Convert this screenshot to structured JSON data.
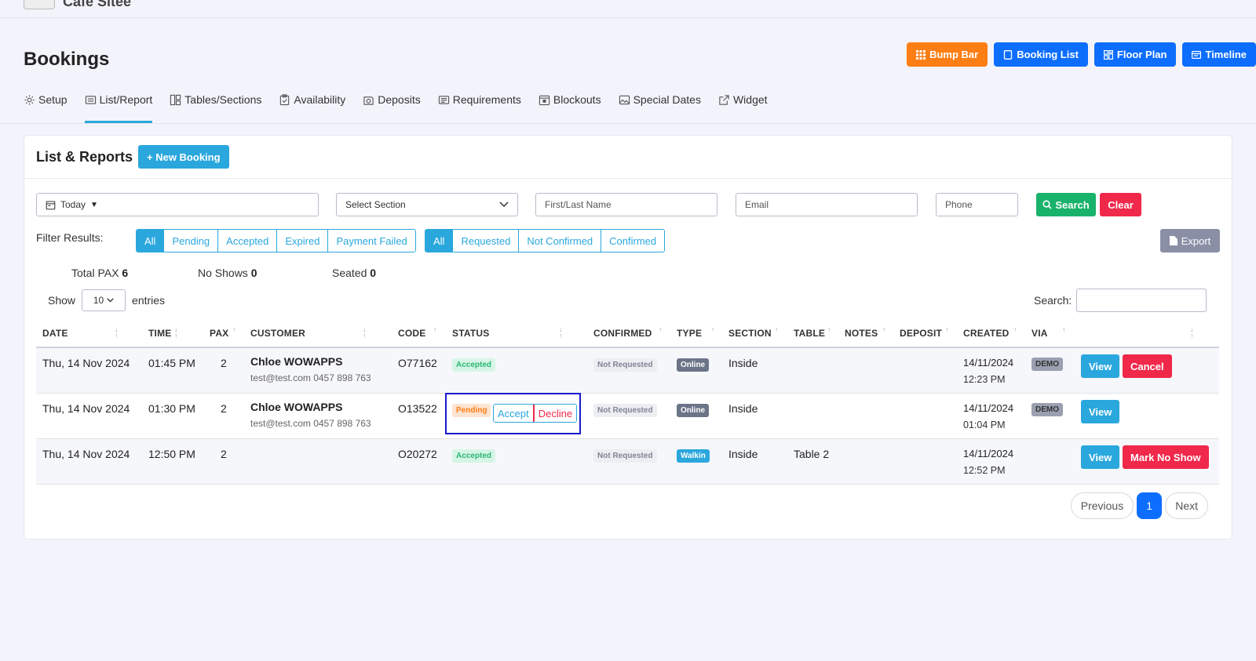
{
  "app": {
    "name": "Cafe Sitee"
  },
  "page": {
    "title": "Bookings"
  },
  "top_buttons": {
    "bump_bar": "Bump Bar",
    "booking_list": "Booking List",
    "floor_plan": "Floor Plan",
    "timeline": "Timeline"
  },
  "tabs": [
    {
      "label": "Setup",
      "icon": "gear-icon"
    },
    {
      "label": "List/Report",
      "icon": "list-icon",
      "active": true
    },
    {
      "label": "Tables/Sections",
      "icon": "tables-icon"
    },
    {
      "label": "Availability",
      "icon": "clipboard-icon"
    },
    {
      "label": "Deposits",
      "icon": "deposit-icon"
    },
    {
      "label": "Requirements",
      "icon": "requirements-icon"
    },
    {
      "label": "Blockouts",
      "icon": "calendar-icon"
    },
    {
      "label": "Special Dates",
      "icon": "image-icon"
    },
    {
      "label": "Widget",
      "icon": "external-link-icon"
    }
  ],
  "card": {
    "title": "List & Reports",
    "new_booking": "+ New Booking"
  },
  "filters": {
    "date_value": "Today",
    "section_placeholder": "Select Section",
    "name_placeholder": "First/Last Name",
    "email_placeholder": "Email",
    "phone_placeholder": "Phone",
    "search_btn": "Search",
    "clear_btn": "Clear",
    "filter_label": "Filter Results:",
    "group1": [
      "All",
      "Pending",
      "Accepted",
      "Expired",
      "Payment Failed"
    ],
    "group2": [
      "All",
      "Requested",
      "Not Confirmed",
      "Confirmed"
    ],
    "export": "Export"
  },
  "stats": {
    "total_pax_label": "Total PAX",
    "total_pax": "6",
    "no_shows_label": "No Shows",
    "no_shows": "0",
    "seated_label": "Seated",
    "seated": "0"
  },
  "table_controls": {
    "show": "Show",
    "entries_value": "10",
    "entries": "entries",
    "search": "Search:"
  },
  "columns": [
    "DATE",
    "TIME",
    "PAX",
    "CUSTOMER",
    "CODE",
    "STATUS",
    "CONFIRMED",
    "TYPE",
    "SECTION",
    "TABLE",
    "NOTES",
    "DEPOSIT",
    "CREATED",
    "VIA"
  ],
  "rows": [
    {
      "date": "Thu, 14 Nov 2024",
      "time": "01:45 PM",
      "pax": "2",
      "customer": "Chloe WOWAPPS",
      "contact": "test@test.com 0457 898 763",
      "code": "O77162",
      "status": "Accepted",
      "confirmed": "Not Requested",
      "type": "Online",
      "section": "Inside",
      "table": "",
      "created_date": "14/11/2024",
      "created_time": "12:23 PM",
      "via": "DEMO",
      "actions": [
        "View",
        "Cancel"
      ]
    },
    {
      "date": "Thu, 14 Nov 2024",
      "time": "01:30 PM",
      "pax": "2",
      "customer": "Chloe WOWAPPS",
      "contact": "test@test.com 0457 898 763",
      "code": "O13522",
      "status": "Pending",
      "accept": "Accept",
      "decline": "Decline",
      "confirmed": "Not Requested",
      "type": "Online",
      "section": "Inside",
      "table": "",
      "created_date": "14/11/2024",
      "created_time": "01:04 PM",
      "via": "DEMO",
      "actions": [
        "View"
      ]
    },
    {
      "date": "Thu, 14 Nov 2024",
      "time": "12:50 PM",
      "pax": "2",
      "customer": "",
      "contact": "",
      "code": "O20272",
      "status": "Accepted",
      "confirmed": "Not Requested",
      "type": "Walkin",
      "section": "Inside",
      "table": "Table 2",
      "created_date": "14/11/2024",
      "created_time": "12:52 PM",
      "via": "",
      "actions": [
        "View",
        "Mark No Show"
      ]
    }
  ],
  "pagination": {
    "previous": "Previous",
    "current": "1",
    "next": "Next"
  }
}
